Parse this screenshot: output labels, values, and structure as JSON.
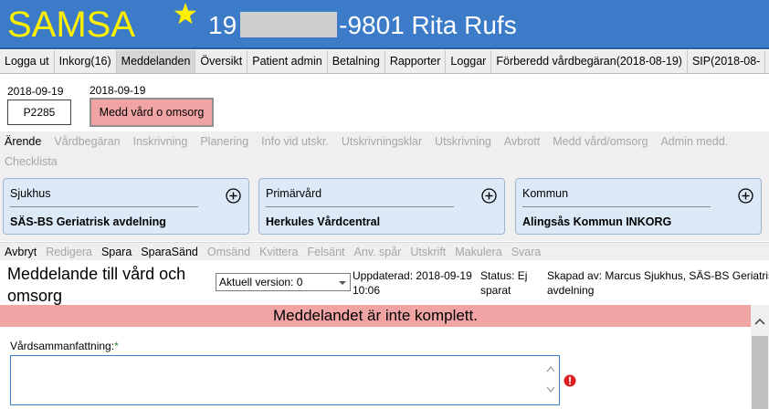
{
  "header": {
    "logo": "SAMSA",
    "patient_prefix": "19",
    "patient_suffix": "-9801 Rita Rufs"
  },
  "menu": [
    {
      "label": "Logga ut"
    },
    {
      "label": "Inkorg(16)"
    },
    {
      "label": "Meddelanden",
      "active": true
    },
    {
      "label": "Översikt"
    },
    {
      "label": "Patient admin"
    },
    {
      "label": "Betalning"
    },
    {
      "label": "Rapporter"
    },
    {
      "label": "Loggar"
    },
    {
      "label": "Förberedd vårdbegäran(2018-08-19)"
    },
    {
      "label": "SIP(2018-08-"
    }
  ],
  "info": {
    "date1": "2018-09-19",
    "code": "P2285",
    "date2": "2018-09-19",
    "message_button": "Medd vård o omsorg"
  },
  "process_tabs": [
    {
      "label": "Ärende",
      "enabled": true
    },
    {
      "label": "Vårdbegäran",
      "enabled": false
    },
    {
      "label": "Inskrivning",
      "enabled": false
    },
    {
      "label": "Planering",
      "enabled": false
    },
    {
      "label": "Info vid utskr.",
      "enabled": false
    },
    {
      "label": "Utskrivningsklar",
      "enabled": false
    },
    {
      "label": "Utskrivning",
      "enabled": false
    },
    {
      "label": "Avbrott",
      "enabled": false
    },
    {
      "label": "Medd vård/omsorg",
      "enabled": false
    },
    {
      "label": "Admin medd.",
      "enabled": false
    },
    {
      "label": "Checklista",
      "enabled": false
    }
  ],
  "cards": [
    {
      "label": "Sjukhus",
      "value": "SÄS-BS Geriatrisk avdelning"
    },
    {
      "label": "Primärvård",
      "value": "Herkules Vårdcentral"
    },
    {
      "label": "Kommun",
      "value": "Alingsås Kommun INKORG"
    }
  ],
  "actions": [
    {
      "label": "Avbryt",
      "enabled": true
    },
    {
      "label": "Redigera",
      "enabled": false
    },
    {
      "label": "Spara",
      "enabled": true
    },
    {
      "label": "SparaSänd",
      "enabled": true
    },
    {
      "label": "Omsänd",
      "enabled": false
    },
    {
      "label": "Kvittera",
      "enabled": false
    },
    {
      "label": "Felsänt",
      "enabled": false
    },
    {
      "label": "Anv. spår",
      "enabled": false
    },
    {
      "label": "Utskrift",
      "enabled": false
    },
    {
      "label": "Makulera",
      "enabled": false
    },
    {
      "label": "Svara",
      "enabled": false
    }
  ],
  "message": {
    "title": "Meddelande till vård och omsorg",
    "version": "Aktuell version: 0",
    "updated_line1": "Uppdaterad: 2018-09-19",
    "updated_line2": "10:06",
    "status_line1": "Status: Ej",
    "status_line2": "sparat",
    "creator_line1": "Skapad av: Marcus Sjukhus, SÄS-BS Geriatrisk",
    "creator_line2": "avdelning"
  },
  "warning": "Meddelandet är inte komplett.",
  "form": {
    "label": "Vårdsammanfattning:",
    "required_mark": "*",
    "value": ""
  },
  "colors": {
    "header_bg": "#3b7bc8",
    "logo": "#ffef00",
    "warning_bg": "#f0a4a4",
    "card_bg": "#dceaf8",
    "error": "#e02020"
  }
}
